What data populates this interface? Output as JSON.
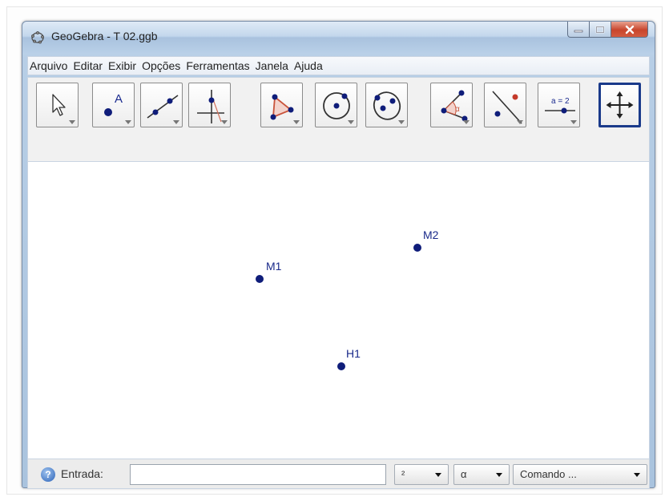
{
  "window": {
    "title": "GeoGebra - T 02.ggb"
  },
  "menu": {
    "items": [
      "Arquivo",
      "Editar",
      "Exibir",
      "Opções",
      "Ferramentas",
      "Janela",
      "Ajuda"
    ]
  },
  "toolbar": {
    "tools": [
      {
        "name": "move-tool",
        "icon": "cursor-arrow-icon",
        "active": false
      },
      {
        "name": "new-point-tool",
        "icon": "point-icon",
        "label": "A",
        "active": false
      },
      {
        "name": "line-tool",
        "icon": "line-through-two-points-icon",
        "active": false
      },
      {
        "name": "perpendicular-line-tool",
        "icon": "perpendicular-line-icon",
        "active": false
      },
      {
        "name": "polygon-tool",
        "icon": "polygon-icon",
        "active": false
      },
      {
        "name": "circle-tool",
        "icon": "circle-center-point-icon",
        "active": false
      },
      {
        "name": "conic-tool",
        "icon": "ellipse-icon",
        "active": false
      },
      {
        "name": "angle-tool",
        "icon": "angle-icon",
        "label": "α",
        "active": false
      },
      {
        "name": "reflect-tool",
        "icon": "reflect-about-line-icon",
        "active": false
      },
      {
        "name": "slider-tool",
        "icon": "slider-icon",
        "label": "a = 2",
        "active": false
      },
      {
        "name": "move-graphics-view-tool",
        "icon": "move-arrows-icon",
        "active": true
      }
    ]
  },
  "canvas": {
    "points": [
      {
        "label": "M1"
      },
      {
        "label": "M2"
      },
      {
        "label": "H1"
      }
    ],
    "point_color": "#0f1d7a"
  },
  "input_bar": {
    "label": "Entrada:",
    "value": "",
    "power_select": "²",
    "symbol_select": "α",
    "command_select": "Comando ..."
  }
}
